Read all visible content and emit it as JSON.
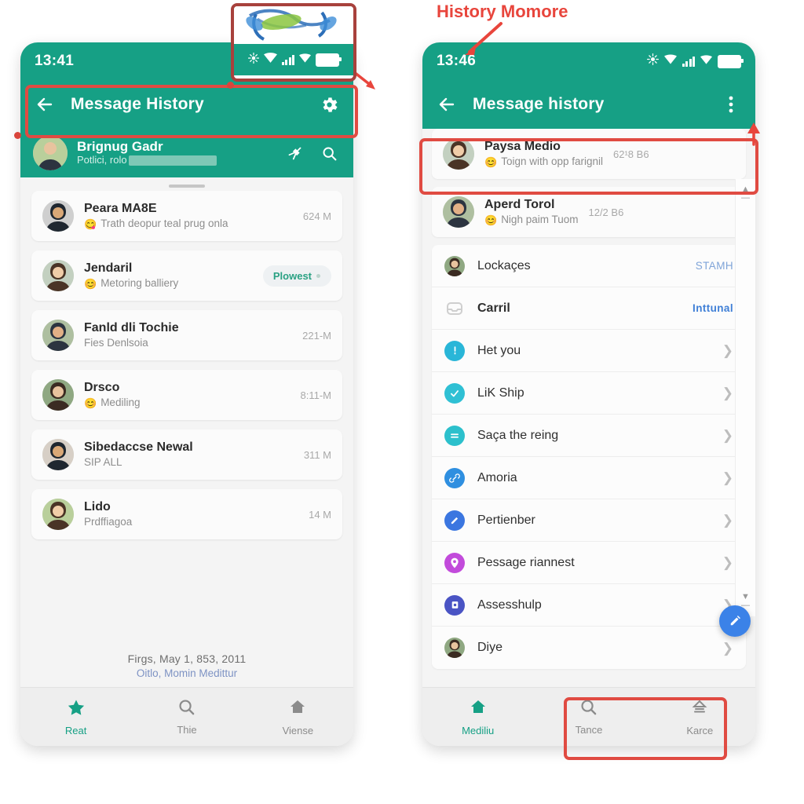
{
  "annotations": {
    "title": "History Momore",
    "accent_color": "#e8453c"
  },
  "left_phone": {
    "status_bar": {
      "time": "13:41",
      "icons": [
        "location-icon",
        "wifi-icon",
        "signal-icon",
        "wifi2-icon",
        "battery-icon"
      ]
    },
    "app_bar": {
      "back_icon": "arrow-left-icon",
      "title": "Message History",
      "action_icon": "gear-icon"
    },
    "profile_strip": {
      "name": "Brignug Gadr",
      "subtitle": "Potlici, rolo",
      "redacted": true,
      "actions": [
        "pin-icon",
        "search-icon"
      ]
    },
    "conversations": [
      {
        "name": "Peara MA8E",
        "emoji": "😋",
        "preview": "Trath deopur teal prug onla",
        "time": "624 M",
        "badge": null
      },
      {
        "name": "Jendaril",
        "emoji": "😊",
        "preview": "Metoring balliery",
        "time": null,
        "badge": "Plowest"
      },
      {
        "name": "Fanld dli Tochie",
        "emoji": "",
        "preview": "Fies Denlsoia",
        "time": "221-M",
        "badge": null
      },
      {
        "name": "Drsco",
        "emoji": "😊",
        "preview": "Mediling",
        "time": "8:11-M",
        "badge": null
      },
      {
        "name": "Sibedaccse Newal",
        "emoji": "",
        "preview": "SIP ALL",
        "time": "311 M",
        "badge": null
      },
      {
        "name": "Lido",
        "emoji": "",
        "preview": "Prdffiagoa",
        "time": "14 M",
        "badge": null
      }
    ],
    "footnote": {
      "line1": "Firgs, May 1, 853, 2011",
      "line2": "Oitlo, Momin Medittur"
    },
    "bottom_nav": [
      {
        "label": "Reat",
        "icon": "star-icon",
        "active": true
      },
      {
        "label": "Thie",
        "icon": "search-icon",
        "active": false
      },
      {
        "label": "Viense",
        "icon": "home-icon",
        "active": false
      }
    ]
  },
  "right_phone": {
    "status_bar": {
      "time": "13:46",
      "icons": [
        "location-icon",
        "wifi-icon",
        "signal-icon",
        "wifi2-icon",
        "battery-icon"
      ]
    },
    "app_bar": {
      "back_icon": "arrow-left-icon",
      "title": "Message history",
      "action_icon": "overflow-menu-icon"
    },
    "conversations": [
      {
        "name": "Paysa Medio",
        "emoji": "😊",
        "preview": "Toign with opp farignil",
        "time": "62¹8 B6",
        "highlighted": true
      },
      {
        "name": "Aperd Torol",
        "emoji": "😊",
        "preview": "Nigh paim Tuom",
        "time": "12/2 B6",
        "highlighted": false
      }
    ],
    "settings": [
      {
        "label": "Lockaçes",
        "icon": "avatar-icon",
        "icon_color": "#9a8b7a",
        "value": "STAMH",
        "value_style": "muted",
        "chevron": false,
        "bold": false
      },
      {
        "label": "Carril",
        "icon": "inbox-icon",
        "icon_color": "#cfcfcf",
        "value": "Inttunal",
        "value_style": "blue",
        "chevron": false,
        "bold": true
      },
      {
        "label": "Het you",
        "icon": "alert-icon",
        "icon_color": "#29b6d8",
        "value": null,
        "value_style": null,
        "chevron": true,
        "bold": false
      },
      {
        "label": "LiK Ship",
        "icon": "check-icon",
        "icon_color": "#2fc0d4",
        "value": null,
        "value_style": null,
        "chevron": true,
        "bold": false
      },
      {
        "label": "Saça the reing",
        "icon": "minus-icon",
        "icon_color": "#2cc0cc",
        "value": null,
        "value_style": null,
        "chevron": true,
        "bold": false
      },
      {
        "label": "Amoria",
        "icon": "link-icon",
        "icon_color": "#2f8fe0",
        "value": null,
        "value_style": null,
        "chevron": true,
        "bold": false
      },
      {
        "label": "Pertienber",
        "icon": "pencil-icon",
        "icon_color": "#3b76e0",
        "value": null,
        "value_style": null,
        "chevron": true,
        "bold": false
      },
      {
        "label": "Pessage riannest",
        "icon": "location-pin-icon",
        "icon_color": "#c24bdb",
        "value": null,
        "value_style": null,
        "chevron": true,
        "bold": false
      },
      {
        "label": "Assesshulp",
        "icon": "file-icon",
        "icon_color": "#4a54c4",
        "value": null,
        "value_style": null,
        "chevron": true,
        "bold": false
      },
      {
        "label": "Diye",
        "icon": "avatar-icon",
        "icon_color": "#8a8a8a",
        "value": null,
        "value_style": null,
        "chevron": true,
        "bold": false
      }
    ],
    "fab": {
      "icon": "compose-icon",
      "color": "#3b82e8"
    },
    "bottom_nav": [
      {
        "label": "Mediliu",
        "icon": "home-icon",
        "active": true
      },
      {
        "label": "Tance",
        "icon": "search-icon",
        "active": false
      },
      {
        "label": "Karce",
        "icon": "home2-icon",
        "active": false
      }
    ]
  }
}
